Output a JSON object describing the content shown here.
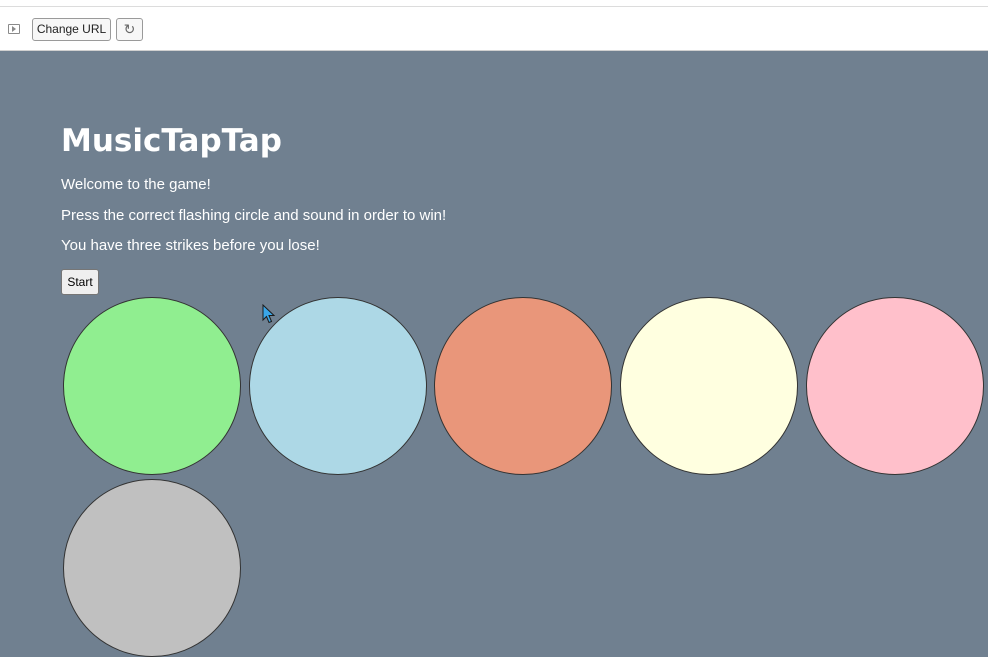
{
  "toolbar": {
    "change_url_label": "Change URL",
    "reload_glyph": "↻"
  },
  "page": {
    "title": "MusicTapTap",
    "welcome": "Welcome to the game!",
    "instructions": "Press the correct flashing circle and sound in order to win!",
    "strikes": "You have three strikes before you lose!",
    "start_label": "Start"
  },
  "colors": {
    "page_background": "#708090",
    "circles": [
      "#90ee90",
      "#add8e6",
      "#e9967a",
      "#ffffe0",
      "#ffc0cb",
      "#c0c0c0"
    ]
  },
  "icons": {
    "panel_toggle": "sidebar-toggle-icon",
    "reload": "reload-icon",
    "cursor": "mouse-cursor-icon"
  }
}
